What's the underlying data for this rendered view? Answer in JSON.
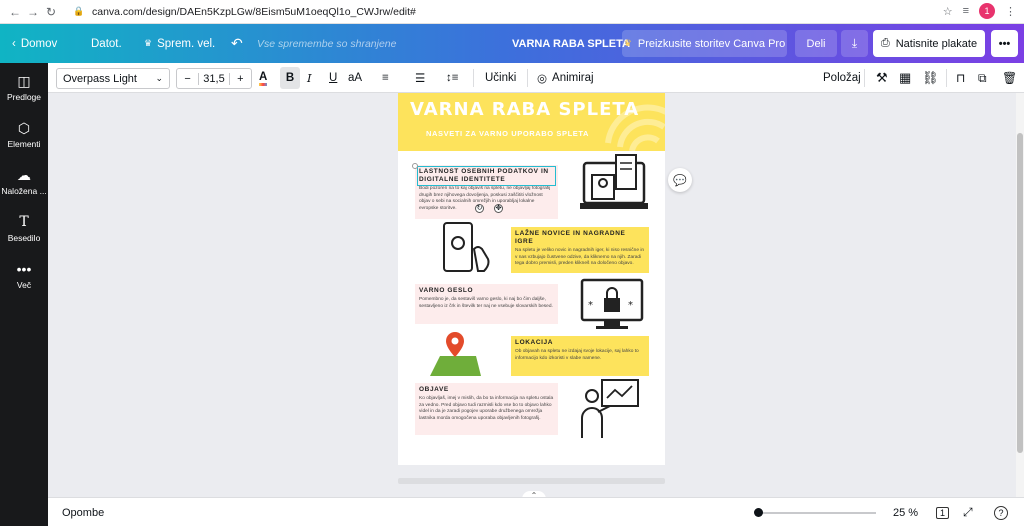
{
  "browser": {
    "url": "canva.com/design/DAEn5KzpLGw/8Eism5uM1oeqQl1o_CWJrw/edit#",
    "profile_initial": "1"
  },
  "header": {
    "home_label": "Domov",
    "file_label": "Datot.",
    "resize_label": "Sprem. vel.",
    "save_status": "Vse spremembe so shranjene",
    "design_title": "VARNA RABA SPLETA",
    "pro_label": "Preizkusite storitev Canva Pro",
    "share_label": "Deli",
    "print_label": "Natisnite plakate",
    "more_label": "•••"
  },
  "sidebar": {
    "items": [
      {
        "label": "Predloge",
        "icon": "template-icon"
      },
      {
        "label": "Elementi",
        "icon": "elements-icon"
      },
      {
        "label": "Naložena ...",
        "icon": "upload-icon"
      },
      {
        "label": "Besedilo",
        "icon": "text-icon"
      },
      {
        "label": "Več",
        "icon": "more-icon"
      }
    ]
  },
  "toolbar": {
    "font_family": "Overpass Light",
    "font_size": "31,5",
    "minus": "−",
    "plus": "+",
    "effects_label": "Učinki",
    "animate_label": "Animiraj",
    "position_label": "Položaj"
  },
  "poster": {
    "title": "VARNA RABA SPLETA",
    "subtitle": "NASVETI ZA VARNO UPORABO SPLETA",
    "sections": [
      {
        "heading": "LASTNOST OSEBNIH PODATKOV IN DIGITALNE IDENTITETE",
        "body": "Bodi pozoren na to kaj objaviš na spletu, ne objavljaj fotografij drugih brez njihovega dovoljenja, poskusi zaščititi vložnost objav o sebi na socialnih omrežjih in uporabljaj lokalne evropske storitve."
      },
      {
        "heading": "LAŽNE NOVICE IN NAGRADNE IGRE",
        "body": "Na spletu je veliko novic in nagradnih iger, ki niso resnične in v nas vzbujajo čustvene odzive, da kliknemo na njih. Zaradi tega dobro premisli, preden klikneš na določeno objavo."
      },
      {
        "heading": "VARNO GESLO",
        "body": "Pomembno je, da sestaviš varno geslo, ki naj bo čim daljše, sestavljeno iz črk in številk ter naj ne vsebuje slovarskih besed."
      },
      {
        "heading": "LOKACIJA",
        "body": "Ob objavah na spletu ne izdajaj svoje lokacije, saj lahko to informacijo kdo izkoristi v slabe namene."
      },
      {
        "heading": "OBJAVE",
        "body": "Ko objavljaš, imej v mislih, da bo ta informacija na spletu ostala za vedno. Pred objavo tudi razmisli kdo vse bo to objavo lahko videl in da je zaradi pogojev uporabe družbenega omrežja lastnika morda omogočena uporaba objavljenih fotografij."
      }
    ]
  },
  "footer": {
    "notes_label": "Opombe",
    "zoom": "25 %",
    "page_count": "1",
    "help": "?"
  },
  "colors": {
    "accent_yellow": "#fde35c",
    "pink_box": "#fdecec",
    "header_gradient_start": "#10b4c4",
    "header_gradient_end": "#7b3fe4"
  }
}
